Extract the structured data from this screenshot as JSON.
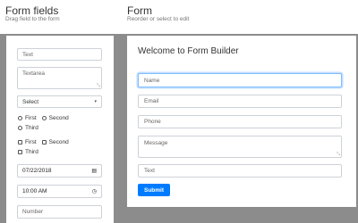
{
  "header": {
    "fields_title": "Form fields",
    "fields_subtitle": "Drag field to the form",
    "form_title": "Form",
    "form_subtitle": "Reorder or select to edit"
  },
  "palette": {
    "text": "Text",
    "textarea": "Textarea",
    "select": "Select",
    "radio_options": [
      "First",
      "Second",
      "Third"
    ],
    "checkbox_options": [
      "First",
      "Second",
      "Third"
    ],
    "date": "07/22/2018",
    "time": "10:00 AM",
    "number": "Number"
  },
  "form": {
    "heading": "Welcome to Form Builder",
    "fields": {
      "name": "Name",
      "email": "Email",
      "phone": "Phone",
      "message": "Message",
      "text": "Text"
    },
    "submit_label": "Submit"
  },
  "colors": {
    "canvas_bg": "#8c8c8c",
    "accent": "#007bff",
    "focus_ring": "#80bdff"
  },
  "icons": {
    "select_caret": "chevron-down-icon",
    "date": "calendar-icon",
    "time": "clock-icon",
    "resize": "resize-handle-icon"
  }
}
